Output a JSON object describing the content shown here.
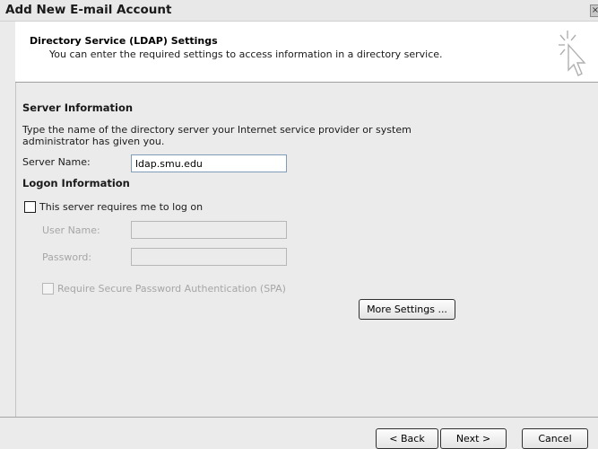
{
  "window": {
    "title": "Add New E-mail Account",
    "close_glyph": "×"
  },
  "header": {
    "title": "Directory Service (LDAP) Settings",
    "subtitle": "You can enter the required settings to access information in a directory service.",
    "icon": "wizard-cursor-icon"
  },
  "server_info": {
    "heading": "Server Information",
    "description": "Type the name of the directory server your Internet service provider or system administrator has given you.",
    "server_name_label": "Server Name:",
    "server_name_value": "ldap.smu.edu"
  },
  "logon_info": {
    "heading": "Logon Information",
    "requires_logon_label": "This server requires me to log on",
    "requires_logon_checked": false,
    "user_name_label": "User Name:",
    "user_name_value": "",
    "password_label": "Password:",
    "password_value": "",
    "spa_label": "Require Secure Password Authentication (SPA)",
    "spa_checked": false
  },
  "buttons": {
    "more_settings": "More Settings ...",
    "back": "< Back",
    "next": "Next >",
    "cancel": "Cancel"
  }
}
